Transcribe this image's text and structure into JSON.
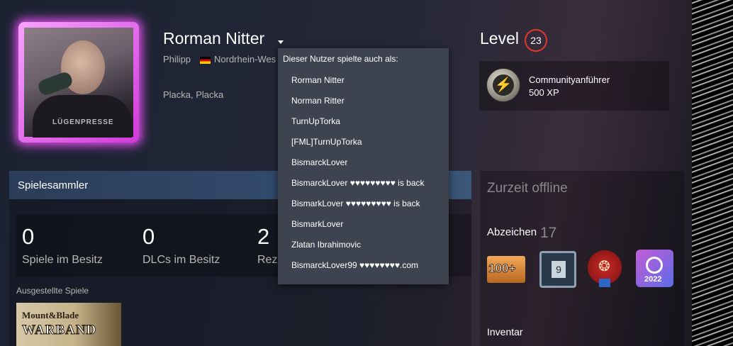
{
  "profile": {
    "name": "Rorman Nitter",
    "real_name": "Philipp",
    "location": "Nordrhein-Wes",
    "summary": "Placka, Placka",
    "avatar_text": "LÜGENPRESSE"
  },
  "level": {
    "label": "Level",
    "value": "23"
  },
  "favorite_badge": {
    "name": "Communityanführer",
    "xp": "500 XP"
  },
  "showcase": {
    "title": "Spielesammler",
    "stats": [
      {
        "value": "0",
        "label": "Spiele im Besitz"
      },
      {
        "value": "0",
        "label": "DLCs im Besitz"
      },
      {
        "value": "2",
        "label": "Rez"
      }
    ],
    "featured_label": "Ausgestellte Spiele",
    "featured_game": {
      "line1": "Mount&Blade",
      "line2": "WARBAND"
    }
  },
  "sidebar": {
    "status": "Zurzeit offline",
    "badges_label": "Abzeichen",
    "badges_count": "17",
    "badges": [
      {
        "icon": "100-plus-badge-icon",
        "text": "100+"
      },
      {
        "icon": "calendar-badge-icon",
        "text": "9"
      },
      {
        "icon": "wax-seal-badge-icon",
        "text": "❂"
      },
      {
        "icon": "steam-2022-badge-icon",
        "text": "2022"
      }
    ],
    "inventory_label": "Inventar"
  },
  "alias_dropdown": {
    "title": "Dieser Nutzer spielte auch als:",
    "aliases": [
      "Rorman Nitter",
      "Norman Ritter",
      "TurnUpTorka",
      "[FML]TurnUpTorka",
      "BismarckLover",
      "BismarckLover ♥♥♥♥♥♥♥♥♥ is back",
      "BismarkLover ♥♥♥♥♥♥♥♥♥ is back",
      "BismarkLover",
      "Zlatan Ibrahimovic",
      "BismarckLover99 ♥♥♥♥♥♥♥♥.com"
    ]
  },
  "colors": {
    "level_ring": "#e0392c",
    "avatar_frame_glow": "#e34ef0",
    "showcase_header": "#324a6c",
    "dropdown_bg": "#3d4450"
  }
}
